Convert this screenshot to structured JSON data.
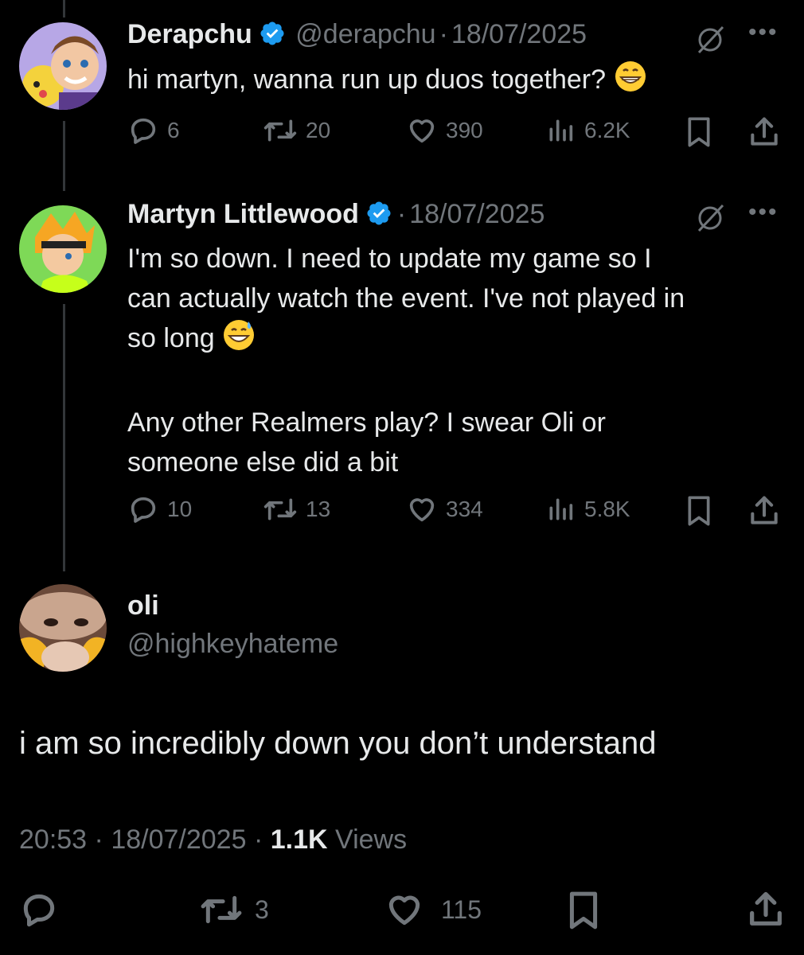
{
  "tweets": [
    {
      "name": "Derapchu",
      "handle": "@derapchu",
      "sep": "·",
      "date": "18/07/2025",
      "text": "hi martyn, wanna run up duos together?",
      "emoji": "😁",
      "replies": "6",
      "retweets": "20",
      "likes": "390",
      "views": "6.2K"
    },
    {
      "name": "Martyn Littlewood",
      "sep": "·",
      "date": "18/07/2025",
      "text_line1": "I'm so down. I need to update my game so I",
      "text_line2": "can actually watch the event. I've not played in",
      "text_line3": "so long",
      "emoji": "😅",
      "text_line4": "Any other Realmers play? I swear Oli or",
      "text_line5": "someone else did a bit",
      "replies": "10",
      "retweets": "13",
      "likes": "334",
      "views": "5.8K"
    }
  ],
  "main_tweet": {
    "name": "oli",
    "handle": "@highkeyhateme",
    "text": "i am so incredibly down you don’t understand",
    "time": "20:53",
    "sep": "·",
    "date": "18/07/2025",
    "views_count": "1.1K",
    "views_label": "Views",
    "retweets": "3",
    "likes": "115"
  },
  "colors": {
    "background": "#000000",
    "text": "#e7e9ea",
    "muted": "#71767b",
    "verified": "#1d9bf0",
    "thread_line": "#333639"
  }
}
